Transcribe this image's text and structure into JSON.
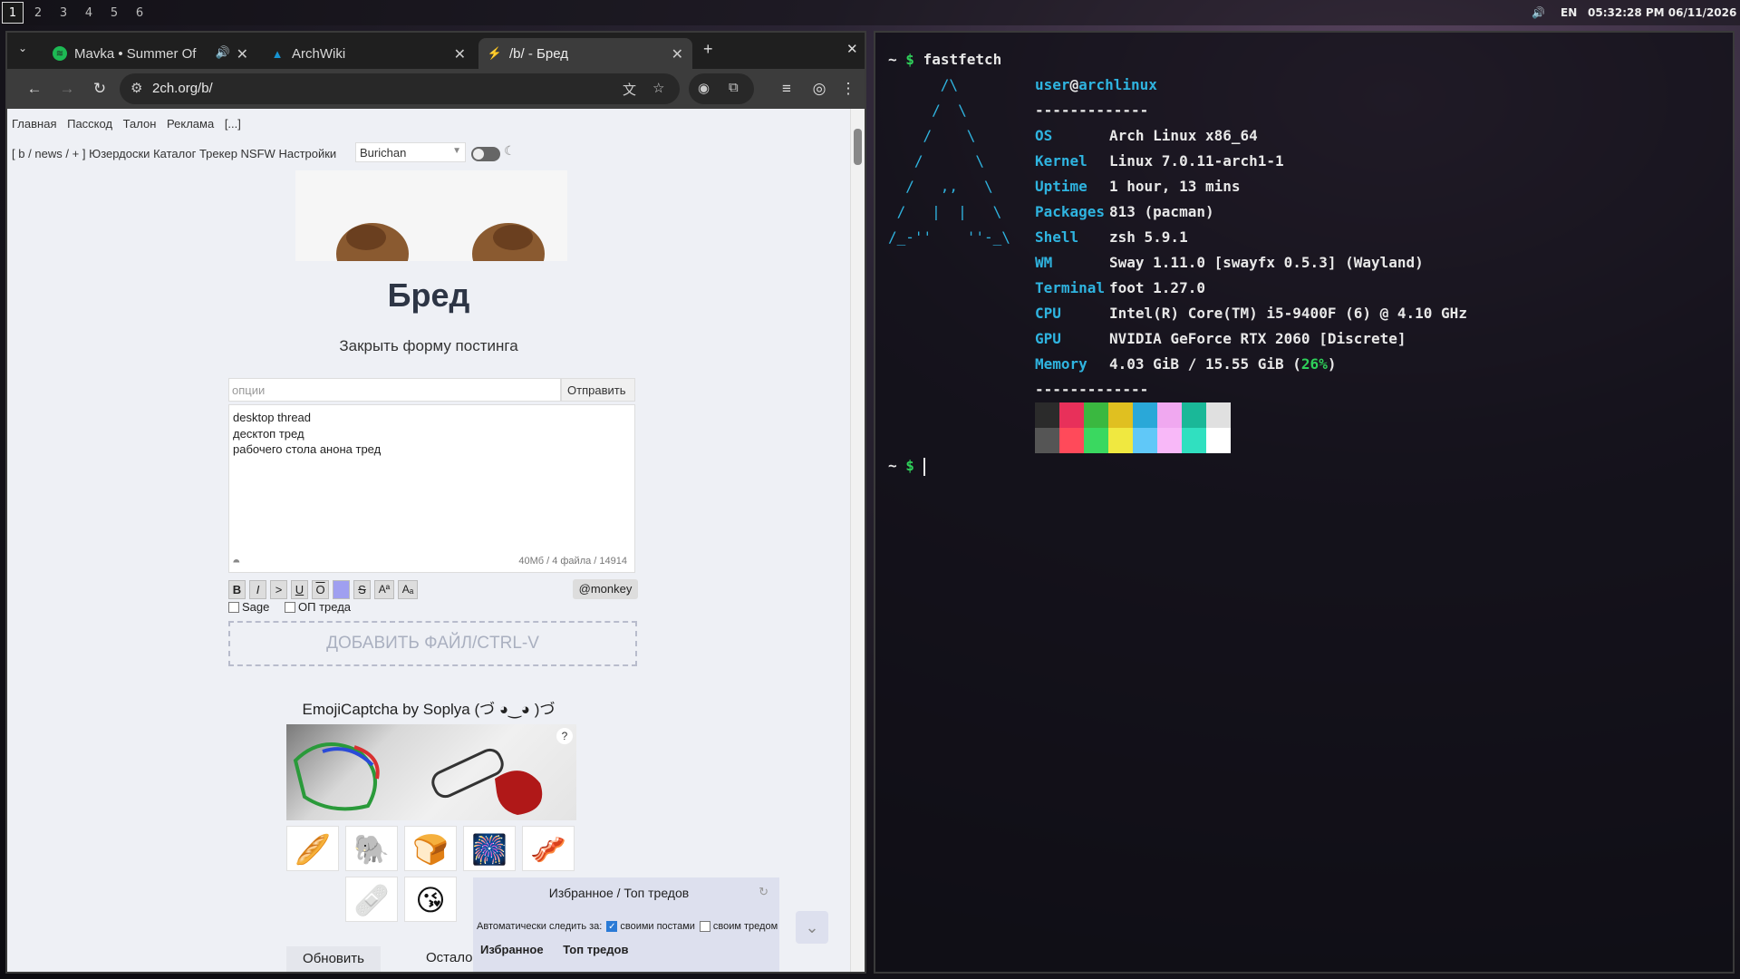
{
  "topbar": {
    "workspaces": [
      "1",
      "2",
      "3",
      "4",
      "5",
      "6"
    ],
    "active_workspace": "1",
    "layout": "EN",
    "datetime": "05:32:28 PM 06/11/2026"
  },
  "browser": {
    "tabs": [
      {
        "title": "Mavka • Summer Of",
        "icon": "spotify-icon"
      },
      {
        "title": "ArchWiki",
        "icon": "arch-icon"
      },
      {
        "title": "/b/ - Бред",
        "icon": "bolt-icon",
        "active": true
      }
    ],
    "new_tab": "+",
    "close_window": "✕",
    "url": "2ch.org/b/",
    "page": {
      "top_nav": [
        "Главная",
        "Пасскод",
        "Талон",
        "Реклама",
        "[...]"
      ],
      "sub_nav": {
        "bracket_open": "[",
        "b": "b",
        "sep1": "/",
        "news": "news",
        "sep2": "/",
        "plus": "+",
        "bracket_close": "]",
        "items": [
          "Юзердоски",
          "Каталог",
          "Трекер",
          "NSFW",
          "Настройки"
        ]
      },
      "style_select": "Burichan",
      "board_title": "Бред",
      "close_form": "Закрыть форму постинга",
      "options_placeholder": "опции",
      "send_button": "Отправить",
      "post_text": [
        "desktop thread",
        "десктоп тред",
        "рабочего стола анона тред"
      ],
      "counter": "40Мб / 4 файла / 14914",
      "format_buttons": [
        "B",
        "I",
        ">",
        "U",
        "O",
        "",
        "S",
        "Aª",
        "Aₐ"
      ],
      "monkey_button": "@monkey",
      "sage_label": "Sage",
      "op_label": "ОП треда",
      "dropzone": "ДОБАВИТЬ ФАЙЛ/CTRL-V",
      "captcha_title": "EmojiCaptcha by Soplya (づ ◕‿◕ )づ",
      "captcha_help": "?",
      "emoji_row1": [
        "🥖",
        "🐘",
        "🍞",
        "🎆",
        "🥓"
      ],
      "emoji_row2": [
        "🩹",
        "😘"
      ],
      "refresh_button": "Обновить",
      "remain_text": "Осталос",
      "favorites": {
        "title": "Избранное / Топ тредов",
        "auto_label": "Автоматически следить за:",
        "own_posts": "своими постами",
        "own_thread": "своим тредом",
        "tab_fav": "Избранное",
        "tab_top": "Топ тредов"
      }
    }
  },
  "terminal": {
    "prompt_symbol": "$",
    "prompt_home": "~",
    "command": "fastfetch",
    "logo": [
      "      /\\",
      "     /  \\",
      "    /    \\",
      "   /      \\",
      "  /   ,,   \\",
      " /   |  |   \\",
      "/_-''    ''-_\\"
    ],
    "user": "user",
    "at": "@",
    "host": "archlinux",
    "separator": "-------------",
    "info": [
      {
        "key": "OS",
        "value": "Arch Linux x86_64"
      },
      {
        "key": "Kernel",
        "value": "Linux 7.0.11-arch1-1"
      },
      {
        "key": "Uptime",
        "value": "1 hour, 13 mins"
      },
      {
        "key": "Packages",
        "value": "813 (pacman)"
      },
      {
        "key": "Shell",
        "value": "zsh 5.9.1"
      },
      {
        "key": "WM",
        "value": "Sway 1.11.0 [swayfx 0.5.3] (Wayland)"
      },
      {
        "key": "Terminal",
        "value": "foot 1.27.0"
      },
      {
        "key": "CPU",
        "value": "Intel(R) Core(TM) i5-9400F (6) @ 4.10 GHz"
      },
      {
        "key": "GPU",
        "value": "NVIDIA GeForce RTX 2060 [Discrete]"
      },
      {
        "key": "Memory",
        "value": "4.03 GiB / 15.55 GiB ("
      }
    ],
    "memory_percent": "26%",
    "memory_close": ")",
    "palette_top": [
      "#2b2b2b",
      "#e8305a",
      "#3ab840",
      "#e0c020",
      "#2aa8d8",
      "#f0a8f0",
      "#1ab898",
      "#e0e0e0"
    ],
    "palette_bottom": [
      "#555555",
      "#ff4a5a",
      "#3ad860",
      "#f0e840",
      "#60c8f8",
      "#f8b8f8",
      "#30e0c0",
      "#ffffff"
    ]
  }
}
